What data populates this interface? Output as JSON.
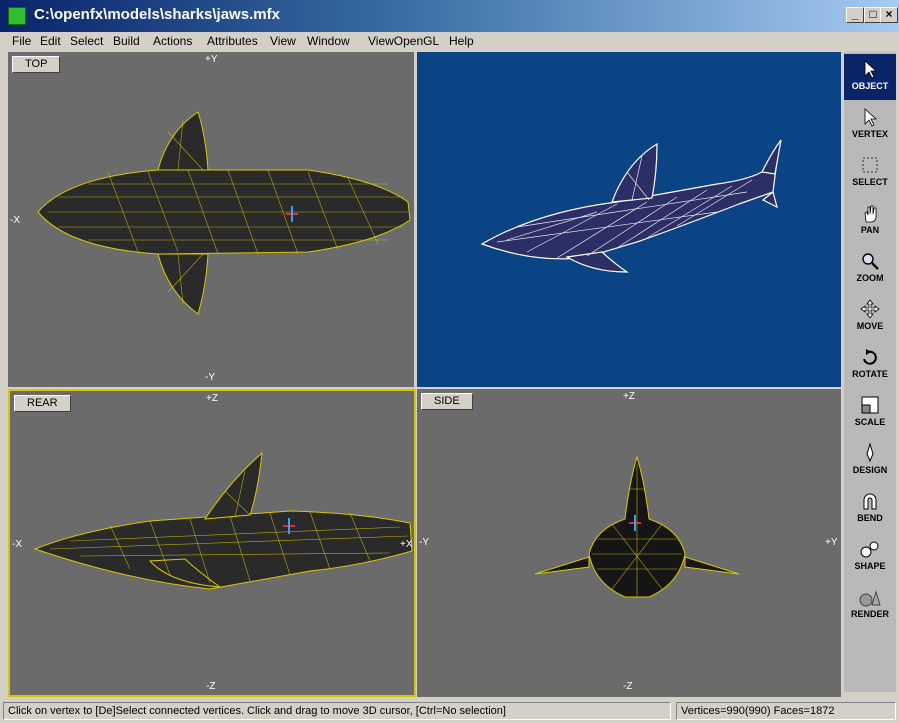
{
  "window": {
    "title": "C:\\openfx\\models\\sharks\\jaws.mfx",
    "minimize": "_",
    "maximize": "□",
    "close": "×"
  },
  "menu": [
    "File",
    "Edit",
    "Select",
    "Build",
    "Actions",
    "Attributes",
    "View",
    "Window",
    "ViewOpenGL",
    "Help"
  ],
  "viewports": {
    "top": {
      "label": "TOP",
      "axis_top": "+Y",
      "axis_bottom": "-Y",
      "axis_left": "-X"
    },
    "rear": {
      "label": "REAR",
      "axis_top": "+Z",
      "axis_bottom": "-Z",
      "axis_left": "-X",
      "axis_right": "+X"
    },
    "side": {
      "label": "SIDE",
      "axis_top": "+Z",
      "axis_bottom": "-Z",
      "axis_left": "-Y",
      "axis_right": "+Y"
    }
  },
  "tools": [
    {
      "name": "object",
      "label": "OBJECT",
      "icon": "arrow-icon"
    },
    {
      "name": "vertex",
      "label": "VERTEX",
      "icon": "vertex-arrow-icon"
    },
    {
      "name": "select",
      "label": "SELECT",
      "icon": "select-box-icon"
    },
    {
      "name": "pan",
      "label": "PAN",
      "icon": "hand-icon"
    },
    {
      "name": "zoom",
      "label": "ZOOM",
      "icon": "magnifier-icon"
    },
    {
      "name": "move",
      "label": "MOVE",
      "icon": "move-arrows-icon"
    },
    {
      "name": "rotate",
      "label": "ROTATE",
      "icon": "rotate-icon"
    },
    {
      "name": "scale",
      "label": "SCALE",
      "icon": "scale-icon"
    },
    {
      "name": "design",
      "label": "DESIGN",
      "icon": "pen-icon"
    },
    {
      "name": "bend",
      "label": "BEND",
      "icon": "magnet-icon"
    },
    {
      "name": "shape",
      "label": "SHAPE",
      "icon": "shapes-icon"
    },
    {
      "name": "render",
      "label": "RENDER",
      "icon": "spheres-icon"
    }
  ],
  "status": {
    "message": "Click on vertex to [De]Select connected vertices. Click and drag to move 3D cursor, [Ctrl=No selection]",
    "counts": "Vertices=990(990) Faces=1872"
  },
  "colors": {
    "wireframe": "#d8c800",
    "viewport_bg": "#6b6b6b",
    "render_bg": "#0a4485",
    "active_border": "#d4c800"
  }
}
